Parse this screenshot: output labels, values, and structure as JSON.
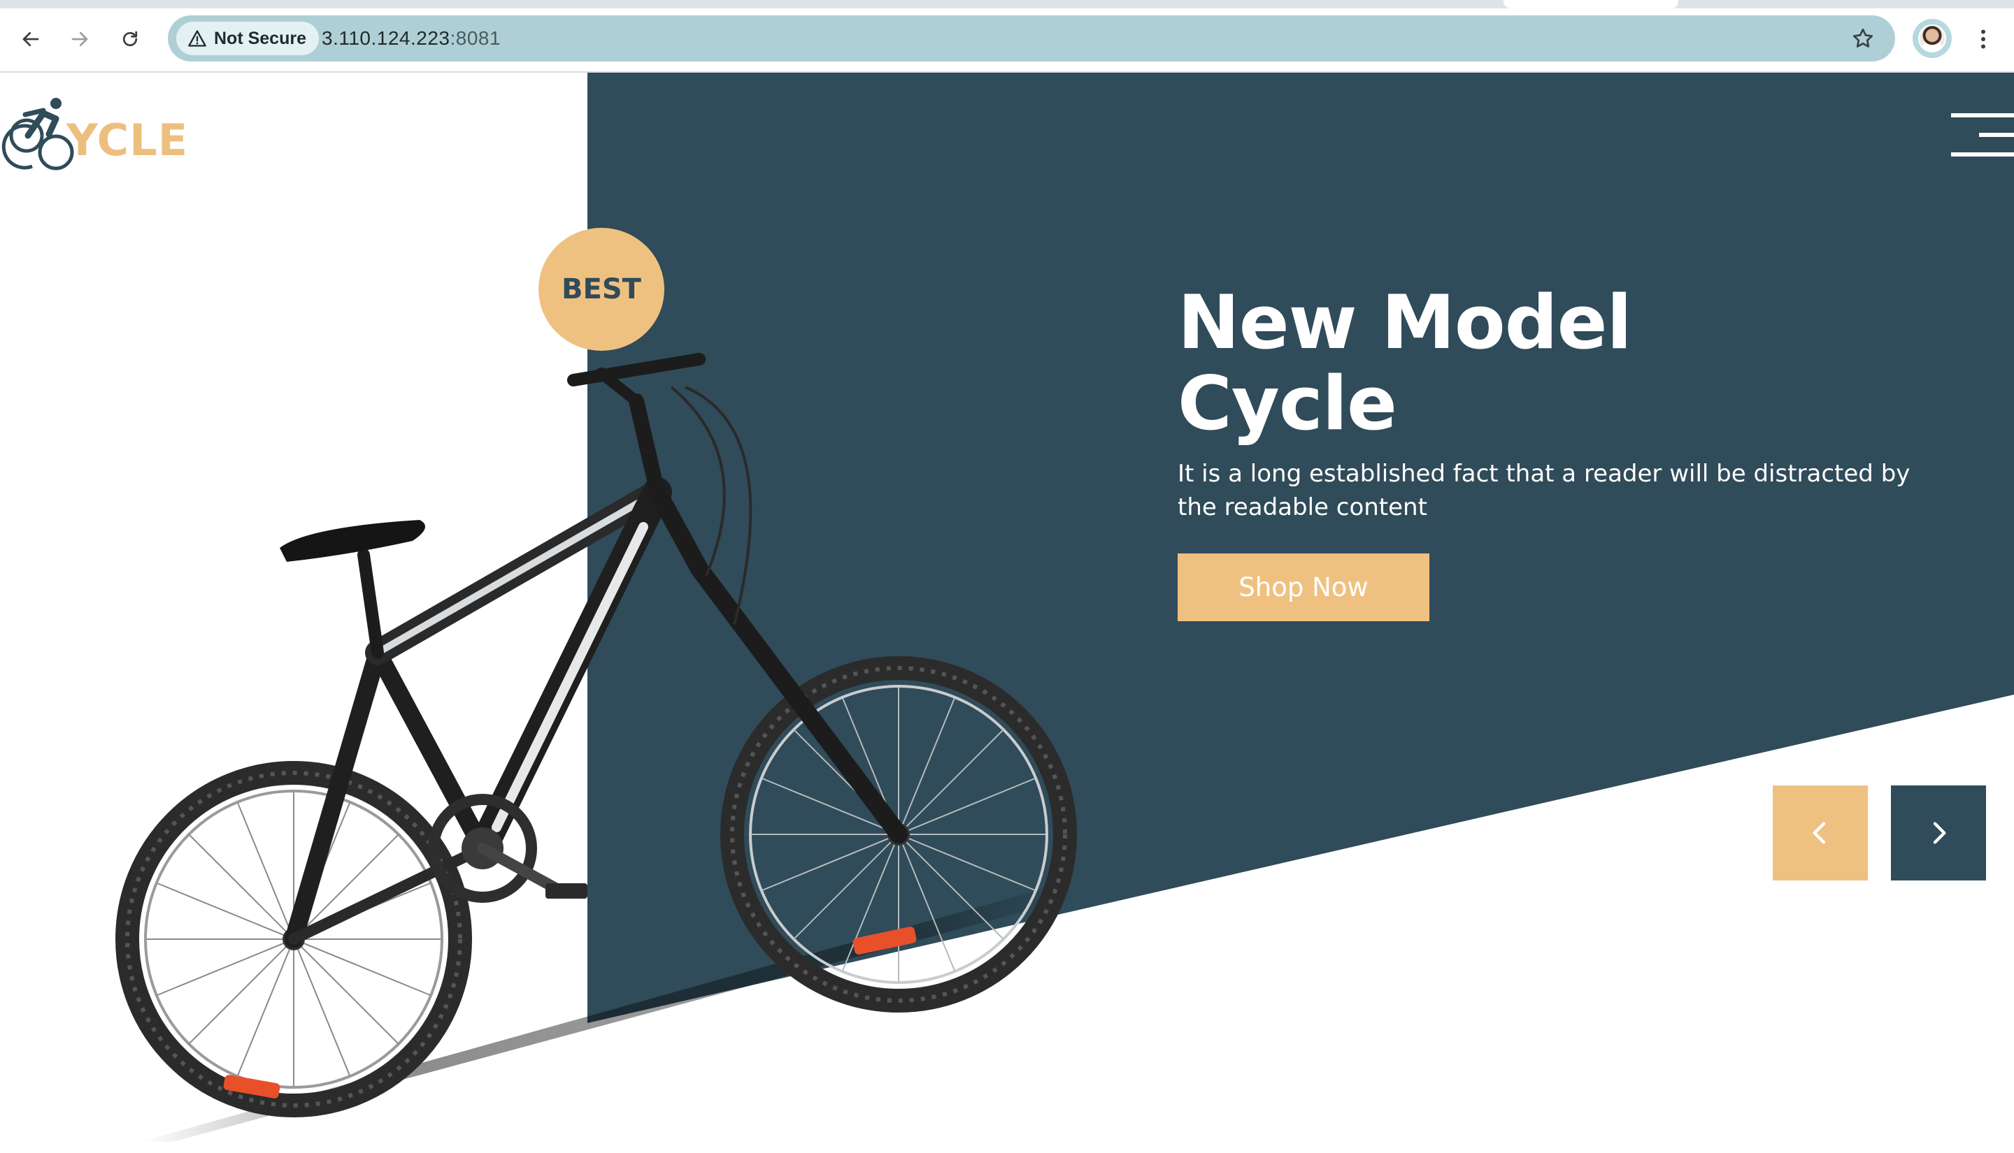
{
  "browser": {
    "security_label": "Not Secure",
    "url_host": "3.110.124.223",
    "url_port": ":8081",
    "icons": [
      "back-arrow-icon",
      "forward-arrow-icon",
      "reload-icon",
      "warning-icon",
      "bookmark-star-icon",
      "profile-avatar",
      "more-vert-icon"
    ]
  },
  "site": {
    "logo_text": "YCLE",
    "badge": "BEST",
    "hero": {
      "title_line1": "New Model",
      "title_line2": "Cycle",
      "description": "It is a long established fact that a reader will be distracted by the readable content",
      "cta_label": "Shop Now"
    },
    "carousel": {
      "prev_icon": "chevron-left-icon",
      "next_icon": "chevron-right-icon"
    },
    "menu_icon": "hamburger-menu-icon"
  },
  "colors": {
    "dark_panel": "#304b59",
    "accent": "#efc180",
    "omnibox": "#aecfd5",
    "white": "#ffffff"
  }
}
